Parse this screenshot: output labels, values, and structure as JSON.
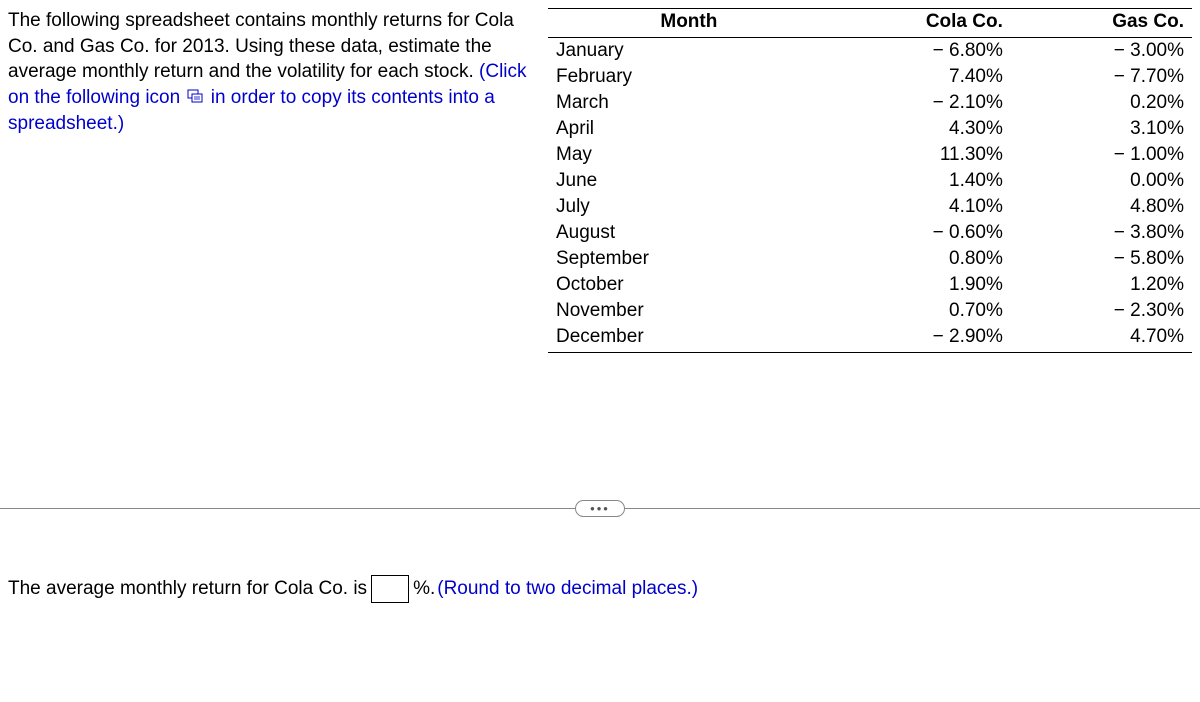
{
  "question": {
    "text_before_link": "The following spreadsheet contains monthly returns for Cola  Co. and Gas Co. for 2013. Using these data, estimate the average monthly return and the volatility for each stock. ",
    "link_part1": "(Click on the following icon ",
    "link_part2": " in order to copy its contents into a spreadsheet.)"
  },
  "table": {
    "headers": {
      "month": "Month",
      "col1": "Cola Co.",
      "col2": "Gas Co."
    },
    "rows": [
      {
        "month": "January",
        "col1": "− 6.80%",
        "col2": "− 3.00%"
      },
      {
        "month": "February",
        "col1": "7.40%",
        "col2": "− 7.70%"
      },
      {
        "month": "March",
        "col1": "− 2.10%",
        "col2": "0.20%"
      },
      {
        "month": "April",
        "col1": "4.30%",
        "col2": "3.10%"
      },
      {
        "month": "May",
        "col1": "11.30%",
        "col2": "− 1.00%"
      },
      {
        "month": "June",
        "col1": "1.40%",
        "col2": "0.00%"
      },
      {
        "month": "July",
        "col1": "4.10%",
        "col2": "4.80%"
      },
      {
        "month": "August",
        "col1": "− 0.60%",
        "col2": "− 3.80%"
      },
      {
        "month": "September",
        "col1": "0.80%",
        "col2": "− 5.80%"
      },
      {
        "month": "October",
        "col1": "1.90%",
        "col2": "1.20%"
      },
      {
        "month": "November",
        "col1": "0.70%",
        "col2": "− 2.30%"
      },
      {
        "month": "December",
        "col1": "− 2.90%",
        "col2": "4.70%"
      }
    ]
  },
  "ellipsis": "•••",
  "answer": {
    "prefix": "The average monthly return for Cola Co. is ",
    "suffix": "%. ",
    "hint": " (Round to two decimal places.)"
  },
  "chart_data": {
    "type": "table",
    "title": "Monthly returns for Cola Co. and Gas Co. for 2013",
    "series": [
      {
        "name": "Cola Co.",
        "values": [
          -6.8,
          7.4,
          -2.1,
          4.3,
          11.3,
          1.4,
          4.1,
          -0.6,
          0.8,
          1.9,
          0.7,
          -2.9
        ]
      },
      {
        "name": "Gas Co.",
        "values": [
          -3.0,
          -7.7,
          0.2,
          3.1,
          -1.0,
          0.0,
          4.8,
          -3.8,
          -5.8,
          1.2,
          -2.3,
          4.7
        ]
      }
    ],
    "categories": [
      "January",
      "February",
      "March",
      "April",
      "May",
      "June",
      "July",
      "August",
      "September",
      "October",
      "November",
      "December"
    ]
  }
}
